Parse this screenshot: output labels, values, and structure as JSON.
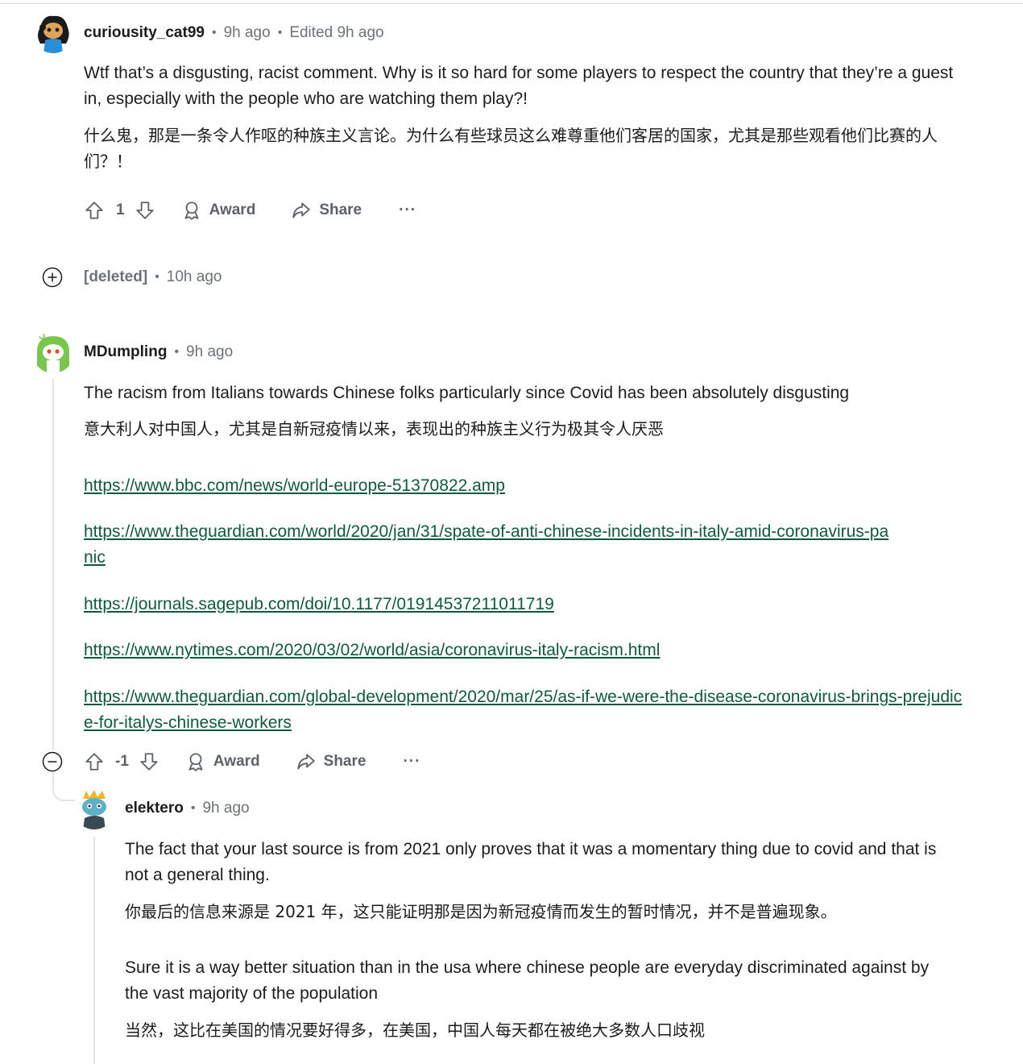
{
  "comments": [
    {
      "author": "curiousity_cat99",
      "time": "9h ago",
      "edited": "Edited 9h ago",
      "text_en": "Wtf that’s a disgusting, racist comment. Why is it so hard for some players to respect the country that they’re a guest in, especially with the people who are watching them play?!",
      "text_cn": "什么鬼，那是一条令人作呕的种族主义言论。为什么有些球员这么难尊重他们客居的国家，尤其是那些观看他们比赛的人们？！",
      "votes": "1",
      "award": "Award",
      "share": "Share",
      "more": "···"
    },
    {
      "author": "[deleted]",
      "time": "10h ago"
    },
    {
      "author": "MDumpling",
      "time": "9h ago",
      "text_en": "The racism from Italians towards Chinese folks particularly since Covid has been absolutely disgusting",
      "text_cn": "意大利人对中国人，尤其是自新冠疫情以来，表现出的种族主义行为极其令人厌恶",
      "links": [
        "https://www.bbc.com/news/world-europe-51370822.amp",
        "https://www.theguardian.com/world/2020/jan/31/spate-of-anti-chinese-incidents-in-italy-amid-coronavirus-panic",
        "https://journals.sagepub.com/doi/10.1177/01914537211011719",
        "https://www.nytimes.com/2020/03/02/world/asia/coronavirus-italy-racism.html",
        "https://www.theguardian.com/global-development/2020/mar/25/as-if-we-were-the-disease-coronavirus-brings-prejudice-for-italys-chinese-workers"
      ],
      "votes": "-1",
      "award": "Award",
      "share": "Share",
      "more": "···"
    },
    {
      "author": "elektero",
      "time": "9h ago",
      "text_en_1": "The fact that your last source is from 2021 only proves that it was a momentary thing due to covid and that is not a general thing.",
      "text_cn_1": "你最后的信息来源是 2021 年，这只能证明那是因为新冠疫情而发生的暂时情况，并不是普遍现象。",
      "text_en_2": "Sure it is a way better situation than in the usa where chinese people are everyday discriminated against by the vast majority of the population",
      "text_cn_2": "当然，这比在美国的情况要好得多，在美国，中国人每天都在被绝大多数人口歧视"
    }
  ],
  "colors": {
    "link": "#0f5a3e",
    "muted": "#6b7378",
    "thread_line": "#e2e5e8"
  }
}
